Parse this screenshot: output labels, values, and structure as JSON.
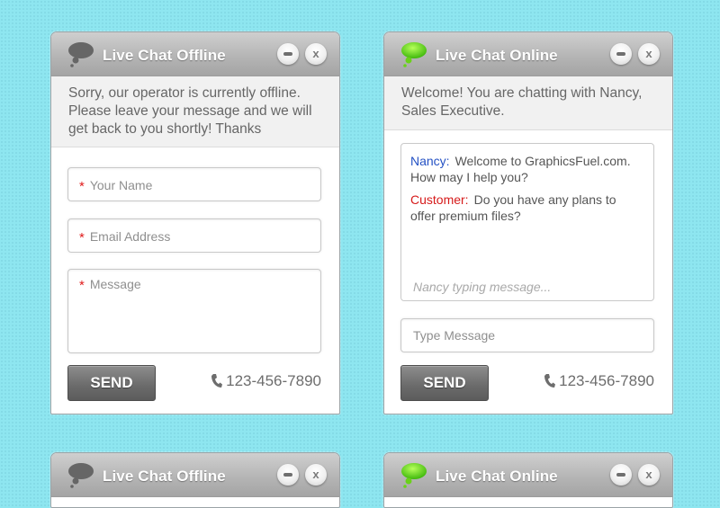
{
  "widgets": [
    {
      "status": "offline",
      "title": "Live Chat Offline",
      "minimize_label": "–",
      "close_label": "x",
      "notice": "Sorry, our operator is currently offline. Please leave your message and we will get back to you shortly! Thanks",
      "fields": {
        "name_placeholder": "Your Name",
        "email_placeholder": "Email Address",
        "message_placeholder": "Message",
        "required_marker": "*"
      },
      "send_label": "SEND",
      "phone": "123-456-7890",
      "icon_color": "#666666"
    },
    {
      "status": "online",
      "title": "Live Chat Online",
      "minimize_label": "–",
      "close_label": "x",
      "notice": "Welcome! You are chatting with Nancy, Sales Executive.",
      "messages": [
        {
          "sender": "Nancy:",
          "text": "Welcome to GraphicsFuel.com. How may I help you?",
          "role": "agent"
        },
        {
          "sender": "Customer:",
          "text": "Do you have any plans to offer premium files?",
          "role": "customer"
        }
      ],
      "typing_status": "Nancy typing message...",
      "input_placeholder": "Type Message",
      "send_label": "SEND",
      "phone": "123-456-7890",
      "icon_color": "#5cd61a"
    },
    {
      "status": "offline",
      "title": "Live Chat Offline",
      "close_label": "x"
    },
    {
      "status": "online",
      "title": "Live Chat Online",
      "close_label": "x"
    }
  ],
  "colors": {
    "background": "#8ee6f0",
    "agent_name": "#2451c4",
    "customer_name": "#d61a1a",
    "required": "#e01b1b"
  }
}
